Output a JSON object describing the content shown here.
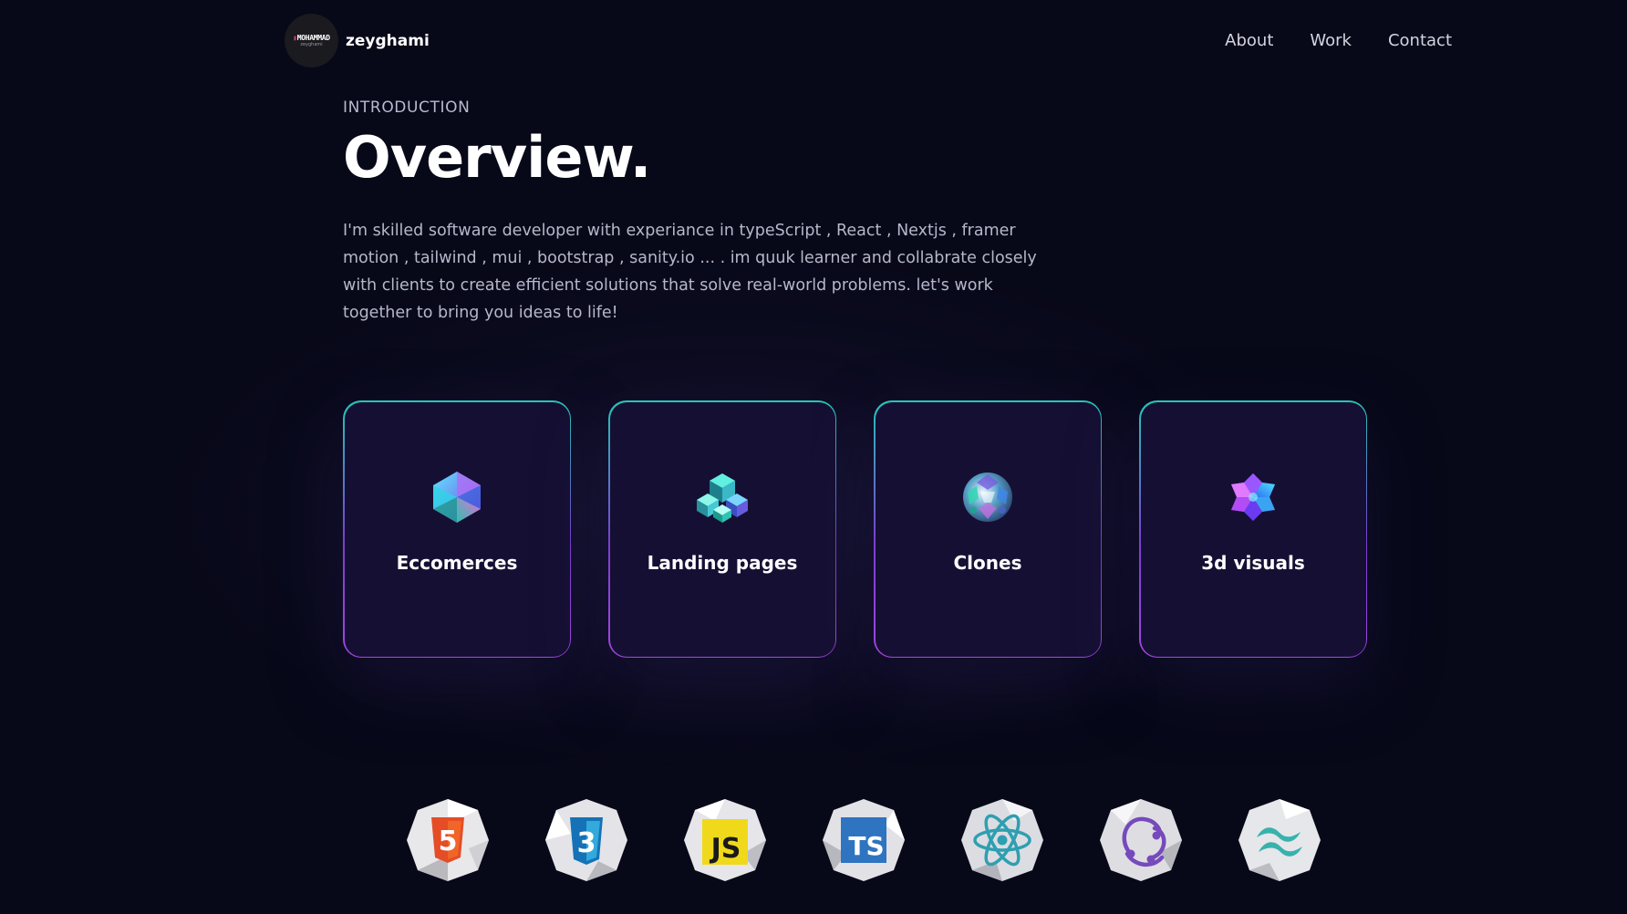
{
  "navbar": {
    "logo_text_top": "MOHAMMAD",
    "logo_text_bottom": "zeyghami",
    "brand_name": "zeyghami",
    "links": [
      {
        "label": "About"
      },
      {
        "label": "Work"
      },
      {
        "label": "Contact"
      }
    ]
  },
  "intro": {
    "kicker": "INTRODUCTION",
    "heading": "Overview.",
    "description": "I'm skilled software developer with experiance in typeScript , React , Nextjs , framer motion , tailwind , mui , bootstrap , sanity.io ... . im quuk learner and collabrate closely with clients to create efficient solutions that solve real-world problems. let's work together to bring you ideas to life!"
  },
  "services": [
    {
      "title": "Eccomerces",
      "icon": "icosahedron-icon"
    },
    {
      "title": "Landing pages",
      "icon": "cube-cluster-icon"
    },
    {
      "title": "Clones",
      "icon": "sphere-mesh-icon"
    },
    {
      "title": "3d visuals",
      "icon": "star-polyhedron-icon"
    }
  ],
  "technologies": [
    {
      "name": "HTML5",
      "icon": "html5-icon",
      "label": "5",
      "color": "#e44d26"
    },
    {
      "name": "CSS3",
      "icon": "css3-icon",
      "label": "3",
      "color": "#1572b6"
    },
    {
      "name": "JavaScript",
      "icon": "javascript-icon",
      "label": "JS",
      "color": "#f0d91a"
    },
    {
      "name": "TypeScript",
      "icon": "typescript-icon",
      "label": "TS",
      "color": "#2f74c0"
    },
    {
      "name": "React",
      "icon": "react-icon",
      "label": "",
      "color": "#2e9fb0"
    },
    {
      "name": "Redux",
      "icon": "redux-icon",
      "label": "",
      "color": "#764abc"
    },
    {
      "name": "Tailwind",
      "icon": "tailwind-icon",
      "label": "",
      "color": "#38b2ac"
    }
  ],
  "colors": {
    "background": "#070818",
    "card": "#151033",
    "card_border_top": "#27c6b6",
    "card_border_bottom": "#a345e0",
    "text_secondary": "#b7b7cb"
  }
}
